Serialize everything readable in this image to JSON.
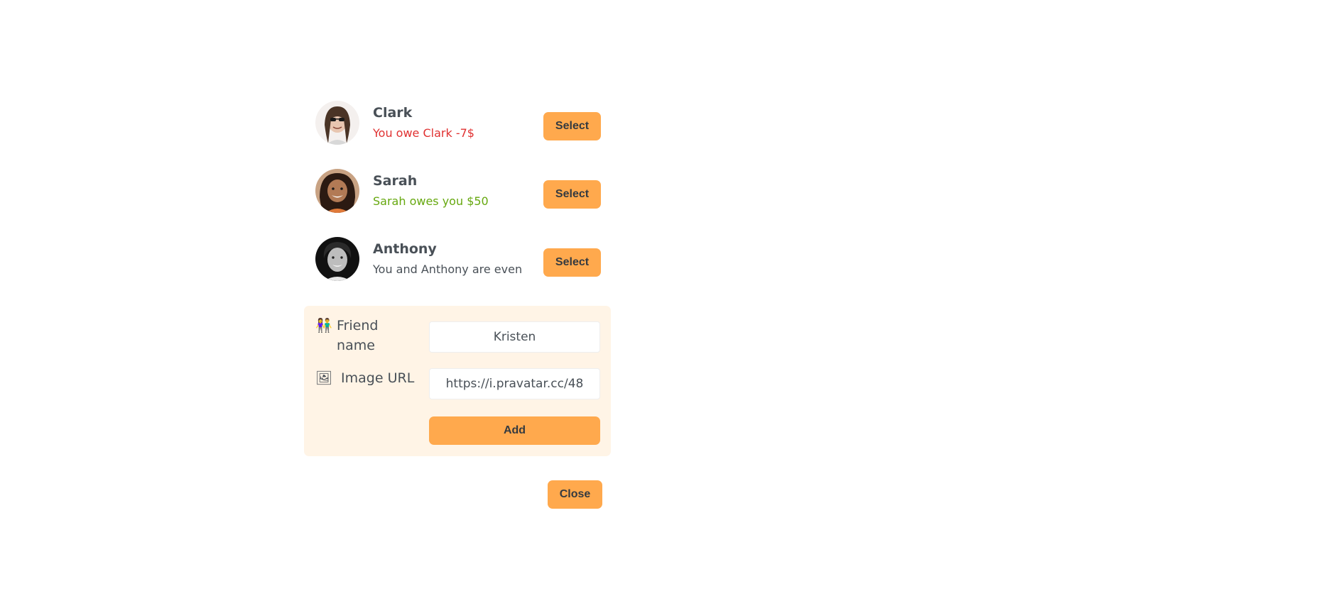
{
  "friends": [
    {
      "name": "Clark",
      "balance_text": "You owe Clark -7$",
      "status": "red",
      "select_label": "Select",
      "avatar_color": "#d9c4b6"
    },
    {
      "name": "Sarah",
      "balance_text": "Sarah owes you $50",
      "status": "green",
      "select_label": "Select",
      "avatar_color": "#8b5a3c"
    },
    {
      "name": "Anthony",
      "balance_text": "You and Anthony are even",
      "status": "grey",
      "select_label": "Select",
      "avatar_color": "#222222"
    }
  ],
  "form": {
    "friend_name_icon": "👫",
    "friend_name_label": "Friend name",
    "friend_name_value": "Kristen",
    "image_url_icon": "🖼",
    "image_url_label": "Image URL",
    "image_url_value": "https://i.pravatar.cc/48",
    "add_label": "Add"
  },
  "close_label": "Close",
  "colors": {
    "accent": "#ffa94d",
    "form_bg": "#fff4e6",
    "red": "#e03131",
    "green": "#66a80f",
    "text": "#495057"
  }
}
